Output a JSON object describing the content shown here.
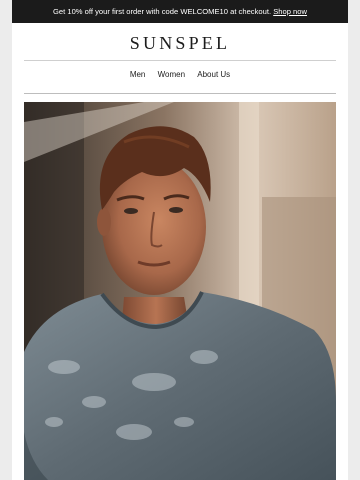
{
  "promo": {
    "text": "Get 10% off your first order with code WELCOME10 at checkout.",
    "link": "Shop now"
  },
  "brand": {
    "logo": "SUNSPEL"
  },
  "nav": {
    "items": [
      "Men",
      "Women",
      "About Us"
    ]
  },
  "hero": {
    "alt": "Man in grey crew-neck t-shirt in dappled sunlight"
  },
  "colors": {
    "promo_bg": "#1b1b1b",
    "tee": "#5f6b73",
    "skin": "#a8684a",
    "hair": "#5a2f1c"
  }
}
